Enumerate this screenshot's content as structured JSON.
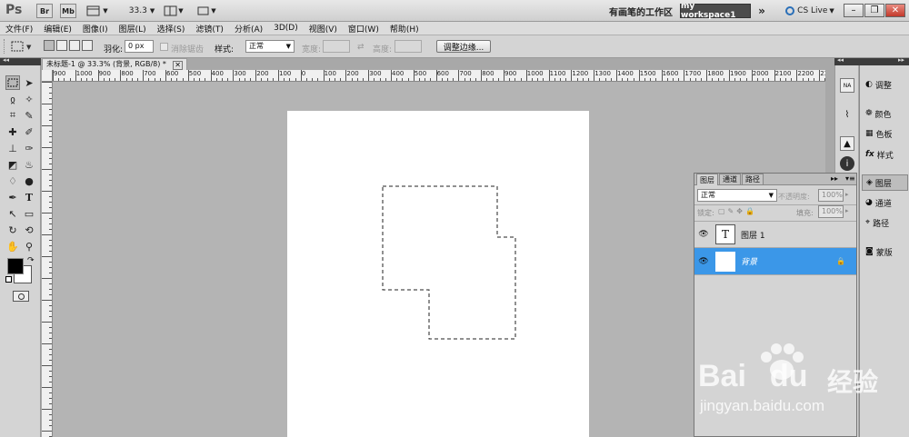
{
  "titlebar": {
    "app_logo": "Ps",
    "br_badge": "Br",
    "mb_badge": "Mb",
    "zoom": "33.3",
    "workspace_label": "有画笔的工作区",
    "workspace_button": "my workspace1",
    "more": "»",
    "cs_live": "CS Live"
  },
  "menu": [
    "文件(F)",
    "编辑(E)",
    "图像(I)",
    "图层(L)",
    "选择(S)",
    "滤镜(T)",
    "分析(A)",
    "3D(D)",
    "视图(V)",
    "窗口(W)",
    "帮助(H)"
  ],
  "options": {
    "feather_label": "羽化:",
    "feather_value": "0 px",
    "antialias_label": "消除锯齿",
    "style_label": "样式:",
    "style_value": "正常",
    "width_label": "宽度:",
    "height_label": "高度:",
    "refine_button": "调整边缘..."
  },
  "document": {
    "tab_title": "未标题-1 @ 33.3% (背景, RGB/8) *"
  },
  "ruler_labels": [
    "900",
    "1000",
    "900",
    "800",
    "700",
    "600",
    "500",
    "400",
    "300",
    "200",
    "100",
    "0",
    "100",
    "200",
    "300",
    "400",
    "500",
    "600",
    "700",
    "800",
    "900",
    "1000",
    "1100",
    "1200",
    "1300",
    "1400",
    "1500",
    "1600",
    "1700",
    "1800",
    "1900",
    "2000",
    "2100",
    "2200",
    "2300",
    "2400",
    "2500"
  ],
  "dock": [
    {
      "icon": "adjustments-icon",
      "label": "调整"
    },
    {
      "icon": "color-icon",
      "label": "颜色"
    },
    {
      "icon": "swatches-icon",
      "label": "色板"
    },
    {
      "icon": "styles-icon",
      "label": "样式"
    },
    {
      "icon": "layers-icon",
      "label": "图层"
    },
    {
      "icon": "channels-icon",
      "label": "通道"
    },
    {
      "icon": "paths-icon",
      "label": "路径"
    },
    {
      "icon": "masks-icon",
      "label": "蒙版"
    }
  ],
  "layers_panel": {
    "tabs": [
      "图层",
      "通道",
      "路径"
    ],
    "blend_mode": "正常",
    "opacity_label": "不透明度:",
    "opacity_value": "100%",
    "lock_label": "锁定:",
    "fill_label": "填充:",
    "fill_value": "100%",
    "layers": [
      {
        "name": "图层 1",
        "thumb": "T",
        "selected": false
      },
      {
        "name": "背景",
        "thumb": "",
        "selected": true
      }
    ]
  },
  "watermark": {
    "brand": "Bai",
    "brand2": "du",
    "cn": "经验",
    "url": "jingyan.baidu.com"
  },
  "colors": {
    "selection_blue": "#3b97e8",
    "canvas_gray": "#b4b4b4"
  }
}
